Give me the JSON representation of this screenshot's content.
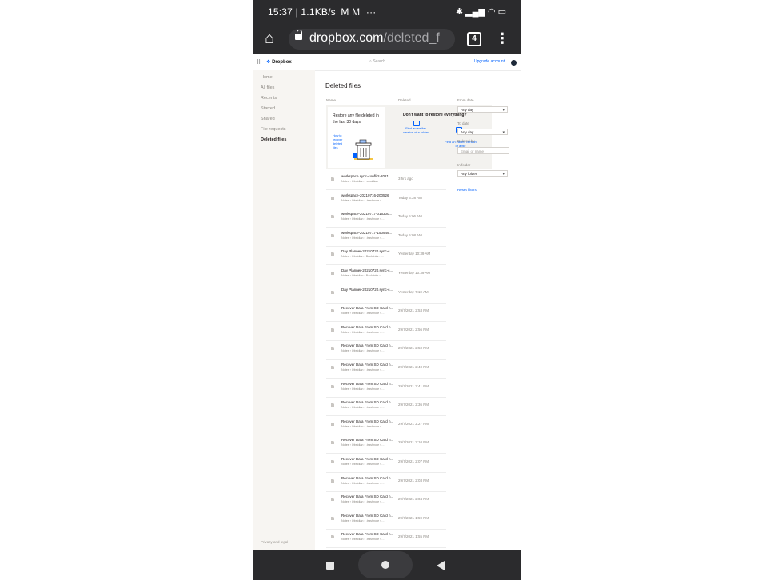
{
  "status_bar": {
    "time_speed": "15:37 | 1.1KB/s",
    "mail_icons": "M M",
    "more": "···",
    "right_icons": "✱ ▂▄▆ ◠ ▭"
  },
  "browser": {
    "url_host": "dropbox.com",
    "url_path": "/deleted_f",
    "tab_count": "4",
    "home_glyph": "⌂",
    "menu_glyph": "⋮"
  },
  "topnav": {
    "grid_glyph": "⠿",
    "brand_mark": "❖",
    "brand": "Dropbox",
    "search_placeholder": "⌕ Search",
    "upgrade": "Upgrade account"
  },
  "sidebar": {
    "items": [
      {
        "label": "Home"
      },
      {
        "label": "All files"
      },
      {
        "label": "Recents"
      },
      {
        "label": "Starred"
      },
      {
        "label": "Shared"
      },
      {
        "label": "File requests"
      },
      {
        "label": "Deleted files"
      }
    ],
    "footer": "Privacy and legal"
  },
  "main": {
    "title": "Deleted files",
    "col_name": "Name",
    "col_deleted": "Deleted"
  },
  "promo": {
    "text": "Restore any file deleted in the last 30 days",
    "link": "How to recover deleted files",
    "question": "Don't want to restore everything?",
    "option1": "Find an earlier version of a folder",
    "option2": "Find an earlier version of a file"
  },
  "filters": {
    "from_label": "From date",
    "from_value": "Any day",
    "to_label": "To date",
    "to_value": "Any day",
    "by_label": "Deleted by",
    "by_placeholder": "Email or name",
    "folder_label": "In folder",
    "folder_value": "Any folder",
    "reset": "Reset filters"
  },
  "files": [
    {
      "name": "workspace sync-conflict-2021...",
      "path": "Notes › Obsidian › .obsidian",
      "date": "3 hrs ago"
    },
    {
      "name": "workspace-20210716-200526",
      "path": "Notes › Obsidian › .trashnote › ...",
      "date": "Today 3:38 AM"
    },
    {
      "name": "workspace-20210717-016300...",
      "path": "Notes › Obsidian › .trashnote › ...",
      "date": "Today 5:06 AM"
    },
    {
      "name": "workspace-20210717-150949...",
      "path": "Notes › Obsidian › .trashnote › ...",
      "date": "Today 5:08 AM"
    },
    {
      "name": "Day Planner-20210720.sync-c...",
      "path": "Notes › Obsidian › Backlinks › ...",
      "date": "Yesterday 10:39 AM"
    },
    {
      "name": "Day Planner-20210720.sync-c...",
      "path": "Notes › Obsidian › Backlinks › ...",
      "date": "Yesterday 10:39 AM"
    },
    {
      "name": "Day Planner-20210720.sync-c...",
      "path": "",
      "date": "Yesterday 7:10 AM"
    },
    {
      "name": "Recover Data From SD Card n...",
      "path": "Notes › Obsidian › .trashnote › ...",
      "date": "29/7/2021 2:53 PM"
    },
    {
      "name": "Recover Data From SD Card n...",
      "path": "Notes › Obsidian › .trashnote › ...",
      "date": "29/7/2021 2:56 PM"
    },
    {
      "name": "Recover Data From SD Card n...",
      "path": "Notes › Obsidian › .trashnote › ...",
      "date": "29/7/2021 2:50 PM"
    },
    {
      "name": "Recover Data From SD Card n...",
      "path": "Notes › Obsidian › .trashnote › ...",
      "date": "29/7/2021 2:40 PM"
    },
    {
      "name": "Recover Data From SD Card n...",
      "path": "Notes › Obsidian › .trashnote › ...",
      "date": "29/7/2021 2:41 PM"
    },
    {
      "name": "Recover Data From SD Card n...",
      "path": "Notes › Obsidian › .trashnote › ...",
      "date": "29/7/2021 2:36 PM"
    },
    {
      "name": "Recover Data From SD Card n...",
      "path": "Notes › Obsidian › .trashnote › ...",
      "date": "29/7/2021 2:27 PM"
    },
    {
      "name": "Recover Data From SD Card n...",
      "path": "Notes › Obsidian › .trashnote › ...",
      "date": "29/7/2021 2:10 PM"
    },
    {
      "name": "Recover Data From SD Card n...",
      "path": "Notes › Obsidian › .trashnote › ...",
      "date": "29/7/2021 2:07 PM"
    },
    {
      "name": "Recover Data From SD Card n...",
      "path": "Notes › Obsidian › .trashnote › ...",
      "date": "29/7/2021 2:03 PM"
    },
    {
      "name": "Recover Data From SD Card n...",
      "path": "Notes › Obsidian › .trashnote › ...",
      "date": "29/7/2021 2:04 PM"
    },
    {
      "name": "Recover Data From SD Card n...",
      "path": "Notes › Obsidian › .trashnote › ...",
      "date": "29/7/2021 1:59 PM"
    },
    {
      "name": "Recover Data From SD Card n...",
      "path": "Notes › Obsidian › .trashnote › ...",
      "date": "29/7/2021 1:55 PM"
    }
  ]
}
